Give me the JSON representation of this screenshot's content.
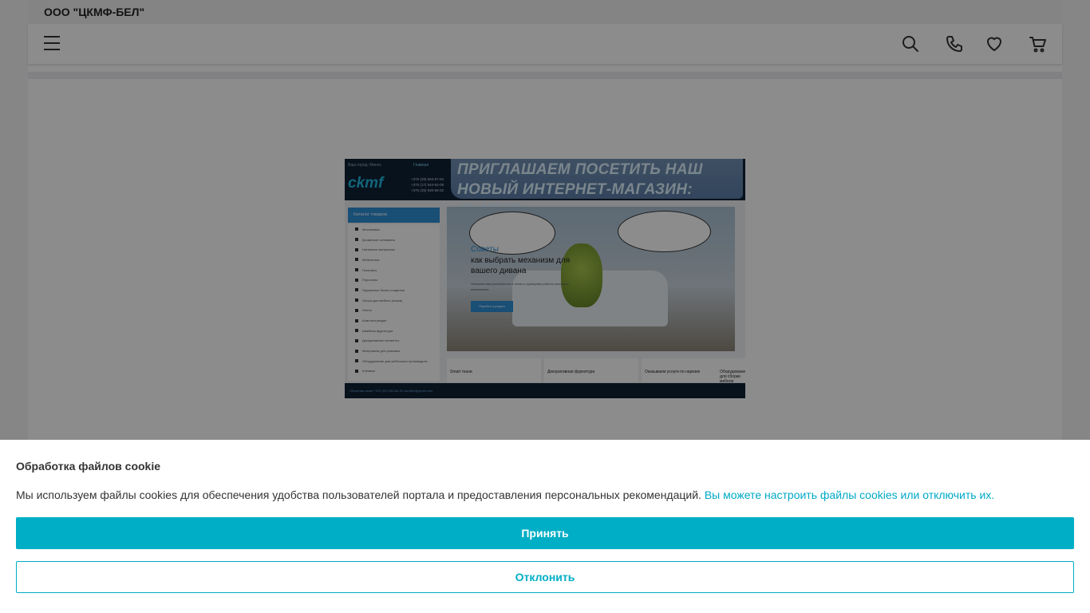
{
  "site": {
    "company_name": "ООО \"ЦКМФ-БЕЛ\""
  },
  "header": {
    "icons": [
      "menu-icon",
      "search-icon",
      "phone-icon",
      "heart-icon",
      "cart-icon"
    ]
  },
  "banner": {
    "city_label": "Ваш город: Минск",
    "logo_text": "ckmf",
    "phones": [
      "+375 (29) 663-97-84",
      "+375 (17) 544-64-08",
      "+375 (29) 930-66-92"
    ],
    "main_link": "Главная",
    "promo_text": "Приглашаем посетить наш новый интернет-магазин: CKMF.BY",
    "catalog_title": "Каталог товаров",
    "catalog_items": [
      "Механизмы",
      "Кроватные основания",
      "Натяжные материалы",
      "Мебельные",
      "Газлифты",
      "Поролоны",
      "Пружинные блоки и изделия",
      "Опоры для мебели (ножки)",
      "Ленты",
      "Комплектующие",
      "Швейная фурнитура",
      "Декоративные элементы",
      "Материалы для упаковки",
      "Оборудование для мебельных производств",
      "Клеевые"
    ],
    "hero_eyebrow": "Советы",
    "hero_title": "как выбрать механизм для вашего дивана",
    "hero_desc": "Поможем вам разобраться в типах и принципах работы основных механизмов",
    "hero_button": "Перейти в раздел",
    "tiles": [
      "Smart ткани",
      "Декоративная фурнитура",
      "Оказываем услуги по нарезке",
      "Оборудование для сборки мебели"
    ],
    "footer_text": "Обратная связь    +375 (29) 330-66-92    ckmfbel@gmail.com"
  },
  "cookie": {
    "title": "Обработка файлов cookie",
    "text": "Мы используем файлы cookies для обеспечения удобства пользователей портала и предоставления персональных рекомендаций.",
    "link_text": "Вы можете настроить файлы cookies или отключить их.",
    "accept_label": "Принять",
    "decline_label": "Отклонить"
  },
  "colors": {
    "accent": "#00aec6",
    "overlay": "rgba(0,0,0,0.45)"
  }
}
